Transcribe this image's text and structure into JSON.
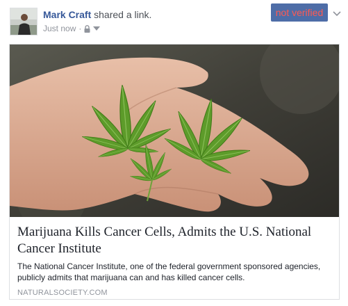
{
  "post": {
    "author": "Mark Craft",
    "action": "shared a link.",
    "timestamp": "Just now",
    "separator": "·",
    "privacy_icon": "lock-icon",
    "audience_icon": "caret-down-icon",
    "badge_label": "not verified",
    "badge_colors": {
      "background": "#4e6da7",
      "text": "#ff5a52"
    },
    "menu_icon": "chevron-down-icon"
  },
  "link": {
    "image_description_icon": "cannabis-leaves-on-hand-photo",
    "title": "Marijuana Kills Cancer Cells, Admits the U.S. National Cancer Institute",
    "description": "The National Cancer Institute, one of the federal government sponsored agencies, publicly admits that marijuana can and has killed cancer cells.",
    "domain": "NATURALSOCIETY.COM"
  }
}
